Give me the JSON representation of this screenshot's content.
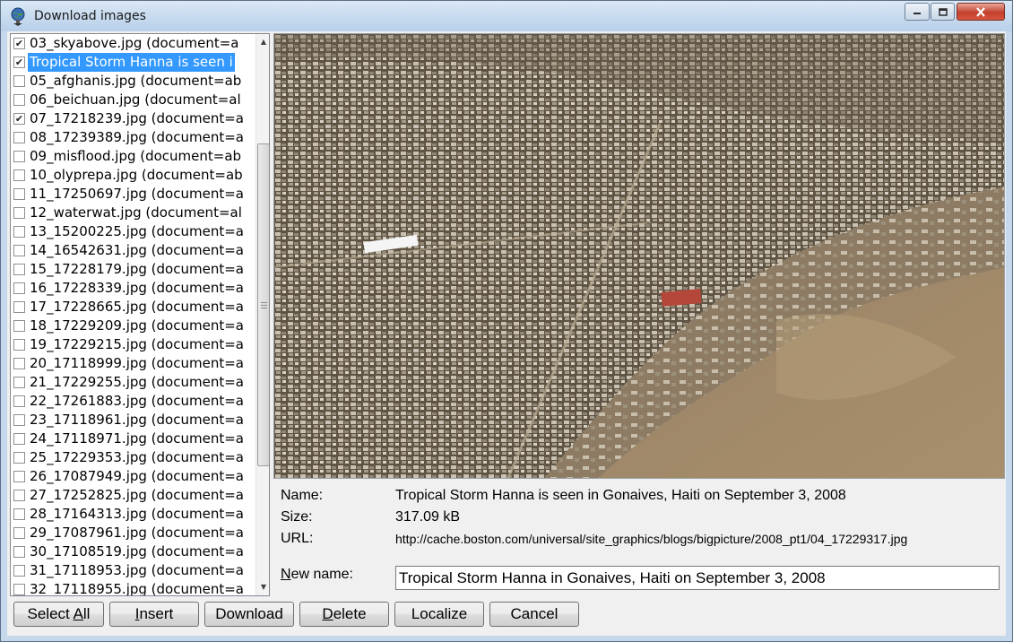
{
  "window": {
    "title": "Download images",
    "icon": "globe-download-icon"
  },
  "file_list": {
    "items": [
      {
        "checked": true,
        "label": "03_skyabove.jpg (document=a",
        "selected": false
      },
      {
        "checked": true,
        "label": "Tropical Storm Hanna is seen i",
        "selected": true
      },
      {
        "checked": false,
        "label": "05_afghanis.jpg (document=ab",
        "selected": false
      },
      {
        "checked": false,
        "label": "06_beichuan.jpg (document=al",
        "selected": false
      },
      {
        "checked": true,
        "label": "07_17218239.jpg (document=a",
        "selected": false
      },
      {
        "checked": false,
        "label": "08_17239389.jpg (document=a",
        "selected": false
      },
      {
        "checked": false,
        "label": "09_misflood.jpg (document=ab",
        "selected": false
      },
      {
        "checked": false,
        "label": "10_olyprepa.jpg (document=ab",
        "selected": false
      },
      {
        "checked": false,
        "label": "11_17250697.jpg (document=a",
        "selected": false
      },
      {
        "checked": false,
        "label": "12_waterwat.jpg (document=al",
        "selected": false
      },
      {
        "checked": false,
        "label": "13_15200225.jpg (document=a",
        "selected": false
      },
      {
        "checked": false,
        "label": "14_16542631.jpg (document=a",
        "selected": false
      },
      {
        "checked": false,
        "label": "15_17228179.jpg (document=a",
        "selected": false
      },
      {
        "checked": false,
        "label": "16_17228339.jpg (document=a",
        "selected": false
      },
      {
        "checked": false,
        "label": "17_17228665.jpg (document=a",
        "selected": false
      },
      {
        "checked": false,
        "label": "18_17229209.jpg (document=a",
        "selected": false
      },
      {
        "checked": false,
        "label": "19_17229215.jpg (document=a",
        "selected": false
      },
      {
        "checked": false,
        "label": "20_17118999.jpg (document=a",
        "selected": false
      },
      {
        "checked": false,
        "label": "21_17229255.jpg (document=a",
        "selected": false
      },
      {
        "checked": false,
        "label": "22_17261883.jpg (document=a",
        "selected": false
      },
      {
        "checked": false,
        "label": "23_17118961.jpg (document=a",
        "selected": false
      },
      {
        "checked": false,
        "label": "24_17118971.jpg (document=a",
        "selected": false
      },
      {
        "checked": false,
        "label": "25_17229353.jpg (document=a",
        "selected": false
      },
      {
        "checked": false,
        "label": "26_17087949.jpg (document=a",
        "selected": false
      },
      {
        "checked": false,
        "label": "27_17252825.jpg (document=a",
        "selected": false
      },
      {
        "checked": false,
        "label": "28_17164313.jpg (document=a",
        "selected": false
      },
      {
        "checked": false,
        "label": "29_17087961.jpg (document=a",
        "selected": false
      },
      {
        "checked": false,
        "label": "30_17108519.jpg (document=a",
        "selected": false
      },
      {
        "checked": false,
        "label": "31_17118953.jpg (document=a",
        "selected": false
      },
      {
        "checked": false,
        "label": "32_17118955.jpg (document=a",
        "selected": false
      }
    ]
  },
  "preview": {
    "subject": "aerial photo of flooded town"
  },
  "details": {
    "name_label": "Name:",
    "name_value": "Tropical Storm Hanna is seen in Gonaives, Haiti on September 3, 2008",
    "size_label": "Size:",
    "size_value": "317.09 kB",
    "url_label": "URL:",
    "url_value": "http://cache.boston.com/universal/site_graphics/blogs/bigpicture/2008_pt1/04_17229317.jpg",
    "new_name_label_accel": "N",
    "new_name_label_rest": "ew name:",
    "new_name_value": "Tropical Storm Hanna in Gonaives, Haiti on September 3, 2008"
  },
  "buttons": {
    "select_all_pre": "Select ",
    "select_all_accel": "A",
    "select_all_post": "ll",
    "insert_accel": "I",
    "insert_rest": "nsert",
    "download": "Download",
    "delete_accel": "D",
    "delete_rest": "elete",
    "localize": "Localize",
    "cancel": "Cancel"
  },
  "colors": {
    "selection": "#3399ff",
    "title_bar": "#c8dbef",
    "close_button": "#c2402c"
  }
}
